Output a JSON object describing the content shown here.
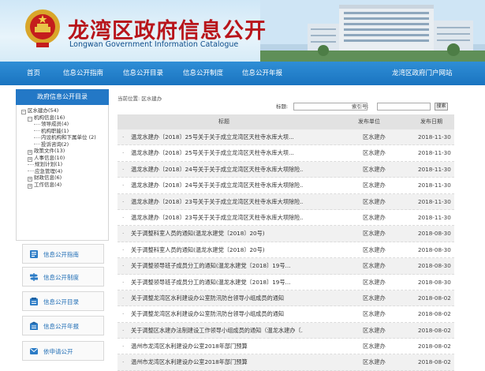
{
  "header": {
    "title_cn": "龙湾区政府信息公开",
    "title_en": "Longwan Government Information Catalogue"
  },
  "nav": {
    "items": [
      "首页",
      "信息公开指南",
      "信息公开目录",
      "信息公开制度",
      "信息公开年报"
    ],
    "portal_link": "龙湾区政府门户网站"
  },
  "sidebar": {
    "heading": "政府信息公开目录",
    "tree": [
      {
        "label": "区水建办(54)",
        "level": 0,
        "toggle": "-"
      },
      {
        "label": "机构信息(16)",
        "level": 1,
        "toggle": "-"
      },
      {
        "label": "领导成员(4)",
        "level": 2,
        "toggle": ""
      },
      {
        "label": "机构职能(1)",
        "level": 2,
        "toggle": ""
      },
      {
        "label": "内设机构和下属单位 (2)",
        "level": 2,
        "toggle": ""
      },
      {
        "label": "投诉咨询(2)",
        "level": 2,
        "toggle": ""
      },
      {
        "label": "政策文件(13)",
        "level": 1,
        "toggle": "+"
      },
      {
        "label": "人事信息(10)",
        "level": 1,
        "toggle": "+"
      },
      {
        "label": "规划计划(1)",
        "level": 1,
        "toggle": ""
      },
      {
        "label": "应急管理(4)",
        "level": 1,
        "toggle": ""
      },
      {
        "label": "财政信息(6)",
        "level": 1,
        "toggle": "+"
      },
      {
        "label": "工作信息(4)",
        "level": 1,
        "toggle": "+"
      }
    ],
    "buttons": [
      {
        "label": "信息公开指南",
        "icon": "guide-icon"
      },
      {
        "label": "信息公开制度",
        "icon": "signpost-icon"
      },
      {
        "label": "信息公开目录",
        "icon": "catalogue-icon"
      },
      {
        "label": "信息公开年报",
        "icon": "report-icon"
      },
      {
        "label": "依申请公开",
        "icon": "application-icon"
      }
    ]
  },
  "breadcrumb": {
    "prefix": "当前位置:",
    "current": "区水建办"
  },
  "search": {
    "title_label": "标题:",
    "index_label": "索引号:",
    "title_value": "",
    "index_value": "",
    "button": "搜索"
  },
  "table": {
    "headers": {
      "title": "标题",
      "unit": "发布单位",
      "date": "发布日期"
    },
    "rows": [
      {
        "title": "温龙水建办〔2018〕25号关于关于成立龙湾区天柱寺水库大坝...",
        "unit": "区水建办",
        "date": "2018-11-30"
      },
      {
        "title": "温龙水建办〔2018〕25号关于关于成立龙湾区天柱寺水库大坝...",
        "unit": "区水建办",
        "date": "2018-11-30"
      },
      {
        "title": "温龙水建办〔2018〕24号关于关于成立龙湾区天柱寺水库大坝除险...",
        "unit": "区水建办",
        "date": "2018-11-30"
      },
      {
        "title": "温龙水建办〔2018〕24号关于关于成立龙湾区天柱寺水库大坝除险...",
        "unit": "区水建办",
        "date": "2018-11-30"
      },
      {
        "title": "温龙水建办〔2018〕23号关于关于成立龙湾区天柱寺水库大坝除险...",
        "unit": "区水建办",
        "date": "2018-11-30"
      },
      {
        "title": "温龙水建办〔2018〕23号关于关于成立龙湾区天柱寺水库大坝除险...",
        "unit": "区水建办",
        "date": "2018-11-30"
      },
      {
        "title": "关于调整科室人员的通知(温龙水建党〔2018〕20号)",
        "unit": "区水建办",
        "date": "2018-08-30"
      },
      {
        "title": "关于调整科室人员的通知(温龙水建党〔2018〕20号)",
        "unit": "区水建办",
        "date": "2018-08-30"
      },
      {
        "title": "关于调整领导班子成员分工的通知(温龙水建党〔2018〕19号...",
        "unit": "区水建办",
        "date": "2018-08-30"
      },
      {
        "title": "关于调整领导班子成员分工的通知(温龙水建党〔2018〕19号...",
        "unit": "区水建办",
        "date": "2018-08-30"
      },
      {
        "title": "关于调整龙湾区水利建设办公室防汛防台领导小组成员的通知",
        "unit": "区水建办",
        "date": "2018-08-02"
      },
      {
        "title": "关于调整龙湾区水利建设办公室防汛防台领导小组成员的通知",
        "unit": "区水建办",
        "date": "2018-08-02"
      },
      {
        "title": "关于调整区水建办法制建设工作领导小组成员的通知（温龙水建办〔...",
        "unit": "区水建办",
        "date": "2018-08-02"
      },
      {
        "title": "温州市龙湾区水利建设办公室2018年部门预算",
        "unit": "区水建办",
        "date": "2018-08-02"
      },
      {
        "title": "温州市龙湾区水利建设办公室2018年部门预算",
        "unit": "区水建办",
        "date": "2018-08-02"
      }
    ]
  }
}
